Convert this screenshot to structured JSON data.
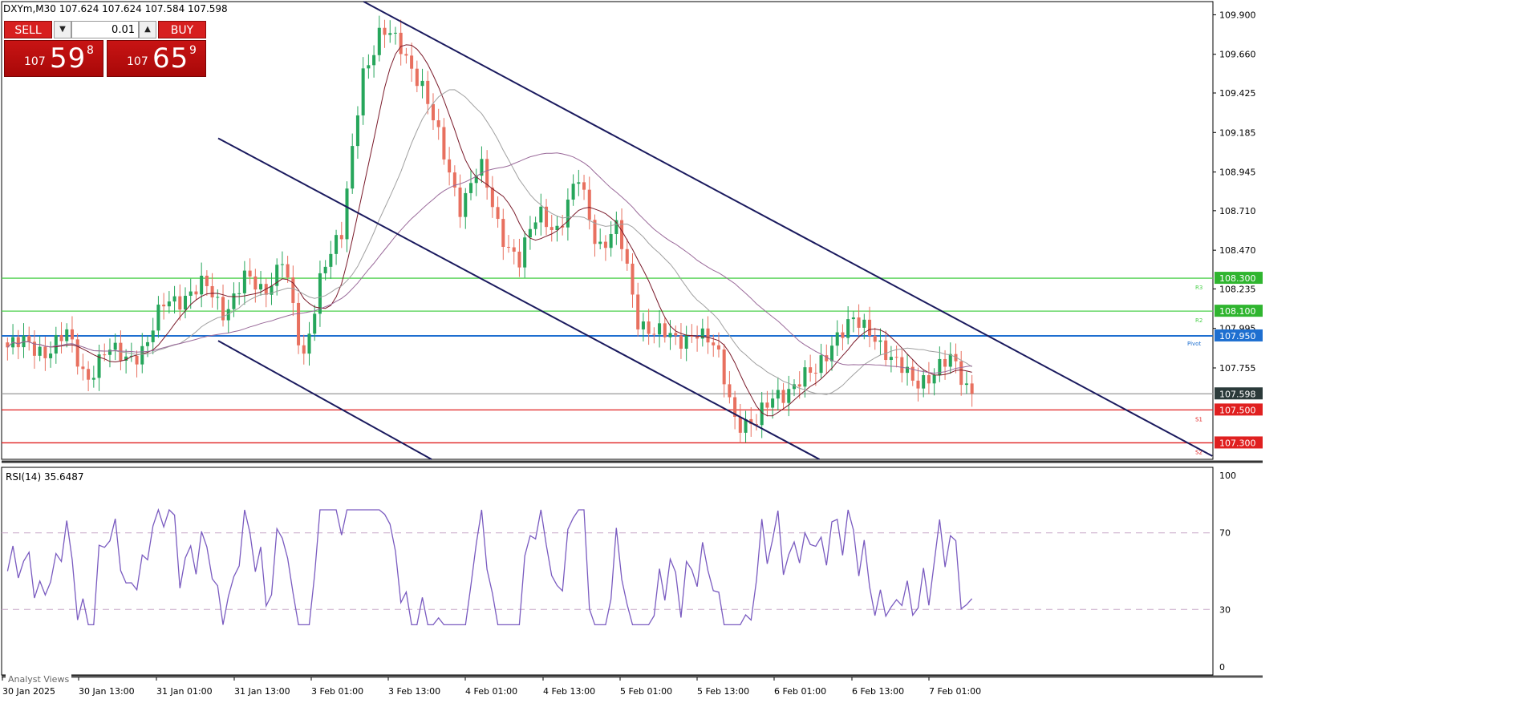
{
  "symbol_info": "DXYm,M30  107.624 107.624 107.584 107.598",
  "trade_panel": {
    "sell_label": "SELL",
    "buy_label": "BUY",
    "lot": "0.01",
    "sell_price_small": "107",
    "sell_price_big": "59",
    "sell_price_sup": "8",
    "buy_price_small": "107",
    "buy_price_big": "65",
    "buy_price_sup": "9"
  },
  "rsi_label": "RSI(14) 35.6487",
  "analyst_views": "Analyst Views",
  "colors": {
    "bull": "#26a65b",
    "bear": "#e8705f",
    "green_level": "#4bd04b",
    "red_level": "#e02020",
    "pivot_level": "#1e6fd0",
    "channel": "#1a1a5e",
    "rsi_line": "#7a5bc0",
    "ma_fast": "#7a1a2a",
    "ma_mid": "#a0a0a0",
    "ma_slow": "#9a6a9a"
  },
  "chart_data": [
    {
      "type": "candlestick",
      "title": "DXYm,M30",
      "y_axis_ticks": [
        "109.900",
        "109.660",
        "109.425",
        "109.185",
        "108.945",
        "108.710",
        "108.470",
        "108.235",
        "107.995",
        "107.755"
      ],
      "ylim": [
        107.2,
        109.98
      ],
      "x_tick_labels": [
        "30 Jan 2025",
        "30 Jan 13:00",
        "31 Jan 01:00",
        "31 Jan 13:00",
        "3 Feb 01:00",
        "3 Feb 13:00",
        "4 Feb 01:00",
        "4 Feb 13:00",
        "5 Feb 01:00",
        "5 Feb 13:00",
        "6 Feb 01:00",
        "6 Feb 13:00",
        "7 Feb 01:00"
      ],
      "levels": [
        {
          "label": "R3",
          "value": "108.300",
          "kind": "resistance"
        },
        {
          "label": "R2",
          "value": "108.100",
          "kind": "resistance"
        },
        {
          "label": "Pivot",
          "value": "107.950",
          "kind": "pivot"
        },
        {
          "label": "",
          "value": "107.598",
          "kind": "current"
        },
        {
          "label": "S1",
          "value": "107.500",
          "kind": "support"
        },
        {
          "label": "S2",
          "value": "107.300",
          "kind": "support"
        }
      ],
      "close_anchors": [
        107.88,
        107.9,
        107.86,
        107.95,
        107.7,
        107.85,
        107.82,
        107.88,
        108.15,
        108.2,
        108.25,
        108.1,
        108.3,
        108.2,
        108.45,
        107.75,
        108.4,
        108.55,
        109.55,
        109.8,
        109.7,
        109.5,
        109.1,
        108.75,
        108.98,
        108.6,
        108.4,
        108.7,
        108.6,
        108.9,
        108.5,
        108.6,
        108.05,
        107.98,
        107.9,
        108.0,
        107.85,
        107.45,
        107.4,
        107.6,
        107.65,
        107.72,
        107.95,
        108.02,
        107.98,
        107.78,
        107.68,
        107.72,
        107.8,
        107.6
      ],
      "rsi": {
        "label": "RSI(14) 35.6487",
        "current": 35.6487,
        "ylim": [
          0,
          100
        ],
        "levels": [
          70,
          30
        ],
        "y_axis_ticks": [
          "100",
          "70",
          "30",
          "0"
        ]
      }
    }
  ]
}
